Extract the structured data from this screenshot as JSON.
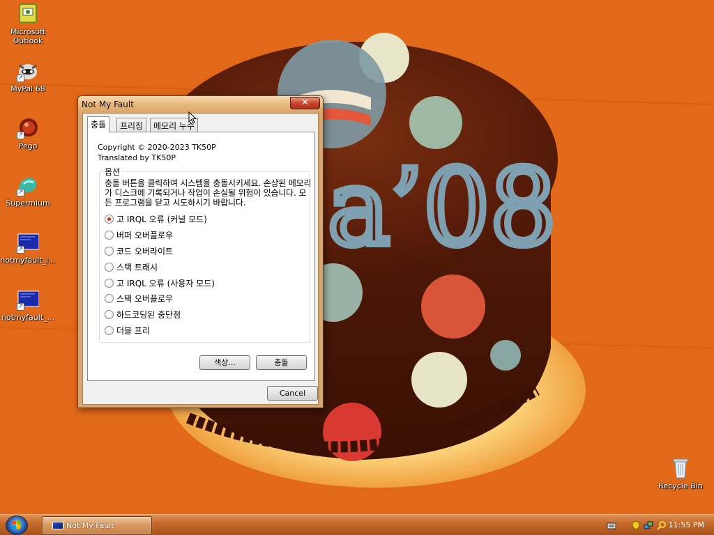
{
  "desktop": {
    "icons": [
      {
        "label": "Microsoft\nOutlook",
        "icon": "outlook-icon"
      },
      {
        "label": "MyPal 68",
        "icon": "mypal-icon"
      },
      {
        "label": "Pego",
        "icon": "pego-icon"
      },
      {
        "label": "Supermium",
        "icon": "supermium-icon"
      },
      {
        "label": "notmyfault_i...",
        "icon": "notmyfault-icon"
      },
      {
        "label": "notmyfault_...",
        "icon": "notmyfault-icon"
      },
      {
        "label": "Recycle Bin",
        "icon": "recycle-bin-icon"
      }
    ]
  },
  "window": {
    "title": "Not My Fault",
    "close_glyph": "✕",
    "tabs": [
      {
        "label": "충돌",
        "active": true
      },
      {
        "label": "프리징",
        "active": false
      },
      {
        "label": "메모리 누수",
        "active": false
      }
    ],
    "copyright_line1": "Copyright © 2020-2023 TK50P",
    "copyright_line2": "Translated by TK50P",
    "group_title": "옵션",
    "group_description": "충돌 버튼을 클릭하여 시스템을 충돌시키세요. 손상된 메모리가 디스크에 기록되거나 작업이 손실될 위험이 있습니다. 모든 프로그램을 닫고 시도하시기 바랍니다.",
    "options": [
      {
        "label": "고 IRQL 오류 (커널 모드)",
        "checked": true
      },
      {
        "label": "버퍼 오버플로우",
        "checked": false
      },
      {
        "label": "코드 오버라이트",
        "checked": false
      },
      {
        "label": "스택 트래시",
        "checked": false
      },
      {
        "label": "고 IRQL 오류 (사용자 모드)",
        "checked": false
      },
      {
        "label": "스택 오버플로우",
        "checked": false
      },
      {
        "label": "하드코딩된 중단점",
        "checked": false
      },
      {
        "label": "더블 프리",
        "checked": false
      }
    ],
    "color_button": "색상...",
    "crash_button": "충돌",
    "cancel_button": "Cancel"
  },
  "taskbar": {
    "task_label": "Not My Fault",
    "clock": "11:55 PM"
  },
  "colors": {
    "wallpaper": "#e06a18",
    "taskbar": "#c66b2c",
    "window_frame": "#d4a673",
    "radio_dot": "#c43a1f"
  }
}
